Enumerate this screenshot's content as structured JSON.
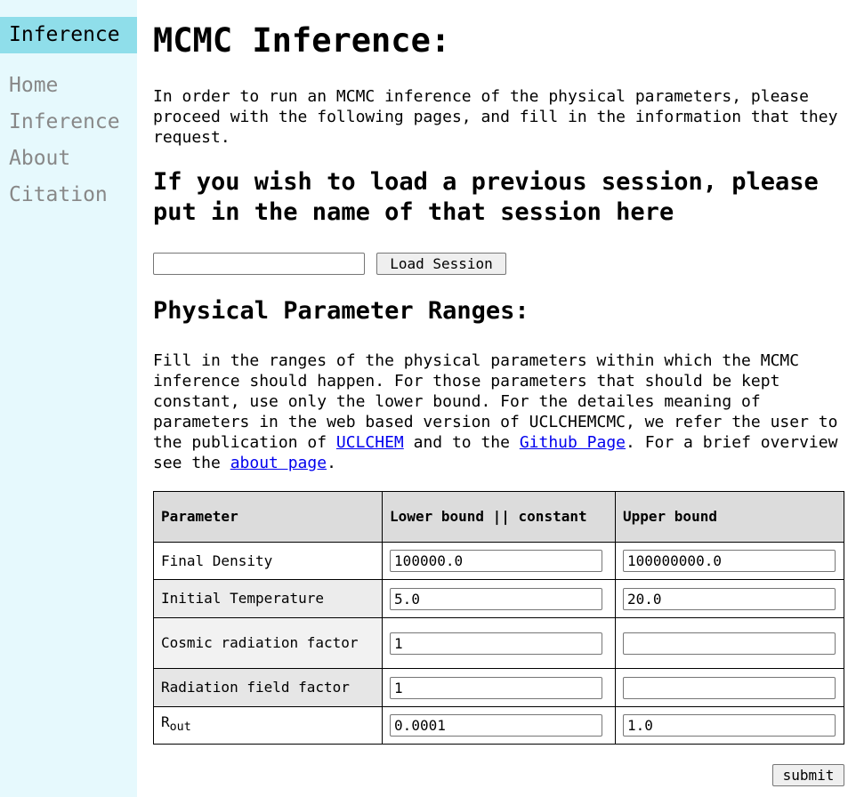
{
  "sidebar": {
    "active": "Inference",
    "items": [
      "Home",
      "Inference",
      "About",
      "Citation"
    ]
  },
  "main": {
    "title": "MCMC Inference:",
    "intro": "In order to run an MCMC inference of the physical parameters, please proceed with the following pages, and fill in the information that they request.",
    "session_heading": "If you wish to load a previous session, please put in the name of that session here",
    "session_value": "",
    "load_button": "Load Session",
    "ranges_heading": "Physical Parameter Ranges:",
    "desc_parts": [
      "Fill in the ranges of the physical parameters within which the MCMC inference should happen. For those parameters that should be kept constant, use only the lower bound. For the detailes meaning of parameters in the web based version of UCLCHEMCMC, we refer the user to the publication of ",
      " and to the ",
      ". For a brief overview see the ",
      "."
    ],
    "desc_links": [
      "UCLCHEM",
      "Github Page",
      "about page"
    ],
    "table": {
      "headers": [
        "Parameter",
        "Lower bound || constant",
        "Upper bound"
      ],
      "rows": [
        {
          "name": "Final Density",
          "lower": "100000.0",
          "upper": "100000000.0"
        },
        {
          "name": "Initial Temperature",
          "lower": "5.0",
          "upper": "20.0"
        },
        {
          "name": "Cosmic radiation factor",
          "lower": "1",
          "upper": ""
        },
        {
          "name": "Radiation field factor",
          "lower": "1",
          "upper": ""
        },
        {
          "name": "R",
          "sub": "out",
          "lower": "0.0001",
          "upper": "1.0"
        }
      ]
    },
    "submit_button": "submit"
  }
}
